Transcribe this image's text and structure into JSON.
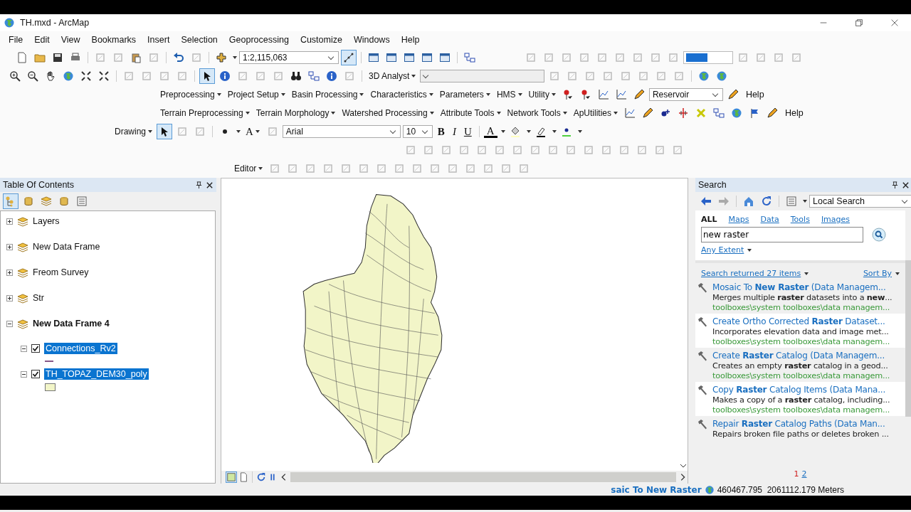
{
  "window": {
    "title": "TH.mxd - ArcMap"
  },
  "menu": [
    "File",
    "Edit",
    "View",
    "Bookmarks",
    "Insert",
    "Selection",
    "Geoprocessing",
    "Customize",
    "Windows",
    "Help"
  ],
  "standard_toolbar": {
    "scale": "1:2,115,063"
  },
  "tools_toolbar": {
    "analyst": "3D Analyst"
  },
  "hydro_toolbar": {
    "menus": [
      "Preprocessing",
      "Project Setup",
      "Basin Processing",
      "Characteristics",
      "Parameters",
      "HMS",
      "Utility"
    ],
    "layer": "Reservoir",
    "help": "Help"
  },
  "arc_hydro_toolbar": {
    "menus": [
      "Terrain Preprocessing",
      "Terrain Morphology",
      "Watershed Processing",
      "Attribute Tools",
      "Network Tools",
      "ApUtilities"
    ],
    "help": "Help"
  },
  "draw_toolbar": {
    "drawing": "Drawing",
    "text_tool": "A",
    "font": "Arial",
    "size": "10",
    "bold": "B",
    "italic": "I",
    "underline": "U",
    "font_color": "A"
  },
  "editor_toolbar": {
    "editor": "Editor"
  },
  "toc": {
    "title": "Table Of Contents",
    "frames": [
      {
        "label": "Layers",
        "expanded": false,
        "active": false
      },
      {
        "label": "New Data Frame",
        "expanded": false,
        "active": false
      },
      {
        "label": "Freom Survey",
        "expanded": false,
        "active": false
      },
      {
        "label": "Str",
        "expanded": false,
        "active": false
      },
      {
        "label": "New Data Frame 4",
        "expanded": true,
        "active": true,
        "children": [
          {
            "label": "Connections_Rv2",
            "checked": true,
            "selected": true,
            "expanded": true,
            "kind": "line"
          },
          {
            "label": "TH_TOPAZ_DEM30_poly",
            "checked": true,
            "selected": true,
            "expanded": true,
            "kind": "polygon"
          }
        ]
      }
    ]
  },
  "search": {
    "title": "Search",
    "scope": "Local Search",
    "tabs": [
      {
        "label": "ALL",
        "selected": true
      },
      {
        "label": "Maps",
        "selected": false
      },
      {
        "label": "Data",
        "selected": false
      },
      {
        "label": "Tools",
        "selected": false
      },
      {
        "label": "Images",
        "selected": false
      }
    ],
    "query": "new raster",
    "extent": "Any Extent",
    "summary": "Search returned 27 items",
    "sort": "Sort By",
    "results": [
      {
        "title": "Mosaic To **New Raster** (Data Managem...",
        "description": "Merges multiple **raster** datasets into a **new**...",
        "path": "toolboxes\\system toolboxes\\data managem..."
      },
      {
        "title": "Create Ortho Corrected **Raster** Dataset...",
        "description": "Incorporates elevation data and image met...",
        "path": "toolboxes\\system toolboxes\\data managem..."
      },
      {
        "title": "Create **Raster** Catalog (Data Managem...",
        "description": "Creates an empty **raster** catalog in a geod...",
        "path": "toolboxes\\system toolboxes\\data managem..."
      },
      {
        "title": "Copy **Raster** Catalog Items (Data Mana...",
        "description": "Makes a copy of a **raster** catalog, including...",
        "path": "toolboxes\\system toolboxes\\data managem..."
      },
      {
        "title": "Repair **Raster** Catalog Paths (Data Man...",
        "description": "Repairs broken file paths or deletes broken ..."
      }
    ],
    "pages": [
      {
        "label": "1",
        "selected": true
      },
      {
        "label": "2",
        "selected": false
      }
    ]
  },
  "status_bar": {
    "message": "saic To New Raster",
    "coordinates": "460467.795  2061112.179 Meters"
  }
}
